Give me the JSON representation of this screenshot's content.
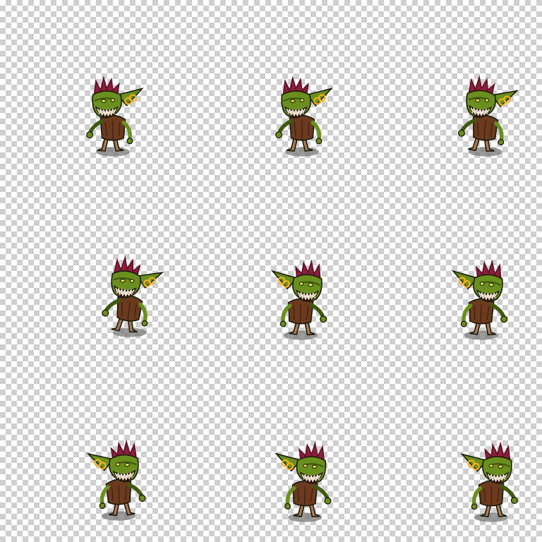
{
  "sheet": {
    "background": "transparent-checkerboard",
    "frame_count": 9,
    "rows": 3,
    "cols": 3
  },
  "palette": {
    "skin": "#6b8f1e",
    "skin_dark": "#3e5a10",
    "mohawk": "#8a1f3a",
    "mohawk_dark": "#5a0f24",
    "earring": "#f0b020",
    "tunic": "#6b3a1f",
    "tunic_dark": "#3f200e",
    "legs": "#b07a58",
    "teeth": "#f2ecd8",
    "mouth": "#3a0a0a",
    "outline": "#1a1a0a",
    "shadow": "#7a7a7a"
  },
  "frames": [
    {
      "id": "frame-1",
      "facing": "right",
      "pose": "idle-1"
    },
    {
      "id": "frame-2",
      "facing": "right",
      "pose": "idle-2"
    },
    {
      "id": "frame-3",
      "facing": "right",
      "pose": "idle-3"
    },
    {
      "id": "frame-4",
      "facing": "right",
      "pose": "lean"
    },
    {
      "id": "frame-5",
      "facing": "left",
      "pose": "walk-1"
    },
    {
      "id": "frame-6",
      "facing": "left",
      "pose": "walk-2"
    },
    {
      "id": "frame-7",
      "facing": "left",
      "pose": "walk-3"
    },
    {
      "id": "frame-8",
      "facing": "left",
      "pose": "walk-4"
    },
    {
      "id": "frame-9",
      "facing": "left",
      "pose": "walk-5"
    }
  ]
}
